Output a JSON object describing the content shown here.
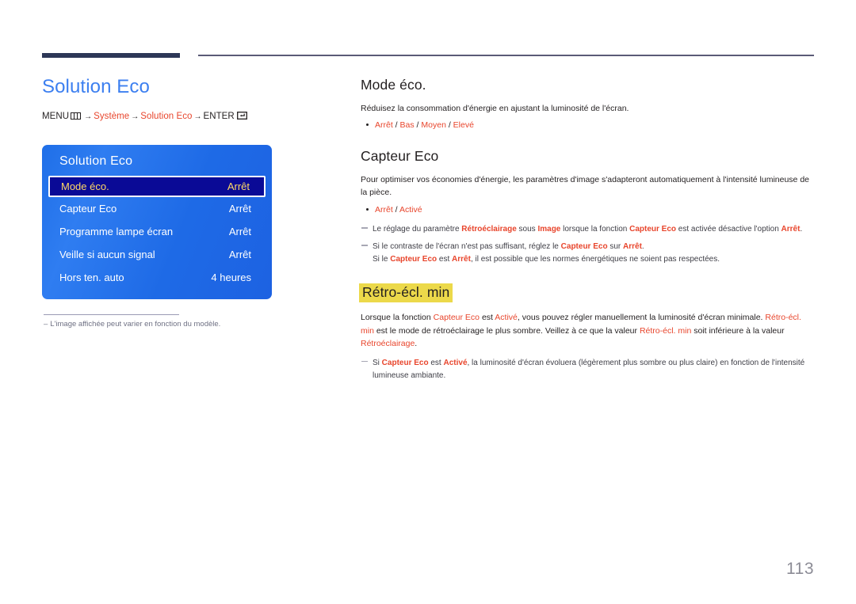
{
  "page": {
    "number": "113"
  },
  "left": {
    "title": "Solution Eco",
    "breadcrumb": {
      "menu_label": "MENU",
      "menu_icon": "menu-grid-icon",
      "arrow": "→",
      "crumb1": "Système",
      "crumb2": "Solution Eco",
      "enter_label": "ENTER",
      "enter_icon": "enter-key-icon"
    },
    "osd": {
      "title": "Solution Eco",
      "rows": [
        {
          "label": "Mode éco.",
          "value": "Arrêt",
          "selected": true
        },
        {
          "label": "Capteur Eco",
          "value": "Arrêt",
          "selected": false
        },
        {
          "label": "Programme lampe écran",
          "value": "Arrêt",
          "selected": false
        },
        {
          "label": "Veille si aucun signal",
          "value": "Arrêt",
          "selected": false
        },
        {
          "label": "Hors ten. auto",
          "value": "4 heures",
          "selected": false
        }
      ]
    },
    "note": "L'image affichée peut varier en fonction du modèle.",
    "note_dash": "–"
  },
  "right": {
    "s1": {
      "heading": "Mode éco.",
      "paragraph": "Réduisez la consommation d'énergie en ajustant la luminosité de l'écran.",
      "option_values": [
        "Arrêt",
        "Bas",
        "Moyen",
        "Elevé"
      ],
      "option_separator": " / "
    },
    "s2": {
      "heading": "Capteur Eco",
      "paragraph": "Pour optimiser vos économies d'énergie, les paramètres d'image s'adapteront automatiquement à l'intensité lumineuse de la pièce.",
      "option_values": [
        "Arrêt",
        "Activé"
      ],
      "option_separator": " / ",
      "note1": {
        "t1": "Le réglage du paramètre ",
        "k1": "Rétroéclairage",
        "t2": " sous ",
        "k2": "Image",
        "t3": " lorsque la fonction ",
        "k3": "Capteur Eco",
        "t4": " est activée désactive l'option ",
        "k4": "Arrêt",
        "t5": "."
      },
      "note2": {
        "t1": "Si le contraste de l'écran n'est pas suffisant, réglez le ",
        "k1": "Capteur Eco",
        "t2": " sur ",
        "k2": "Arrêt",
        "t3": ".",
        "t4": "Si le ",
        "k3": "Capteur Eco",
        "t5": " est ",
        "k4": "Arrêt",
        "t6": ", il est possible que les normes énergétiques ne soient pas respectées."
      }
    },
    "s3": {
      "heading": "Rétro-écl. min",
      "paragraph": {
        "t1": "Lorsque la fonction ",
        "k1": "Capteur Eco",
        "t2": " est ",
        "k2": "Activé",
        "t3": ", vous pouvez régler manuellement la luminosité d'écran minimale. ",
        "k3": "Rétro-écl. min",
        "t4": " est le mode de rétroéclairage le plus sombre. Veillez à ce que la valeur ",
        "k4": "Rétro-écl. min",
        "t5": " soit inférieure à la valeur ",
        "k5": "Rétroéclairage",
        "t6": "."
      },
      "note1": {
        "t1": "Si ",
        "k1": "Capteur Eco",
        "t2": " est ",
        "k2": "Activé",
        "t3": ", la luminosité d'écran évoluera (légèrement plus sombre ou plus claire) en fonction de l'intensité lumineuse ambiante."
      }
    }
  }
}
